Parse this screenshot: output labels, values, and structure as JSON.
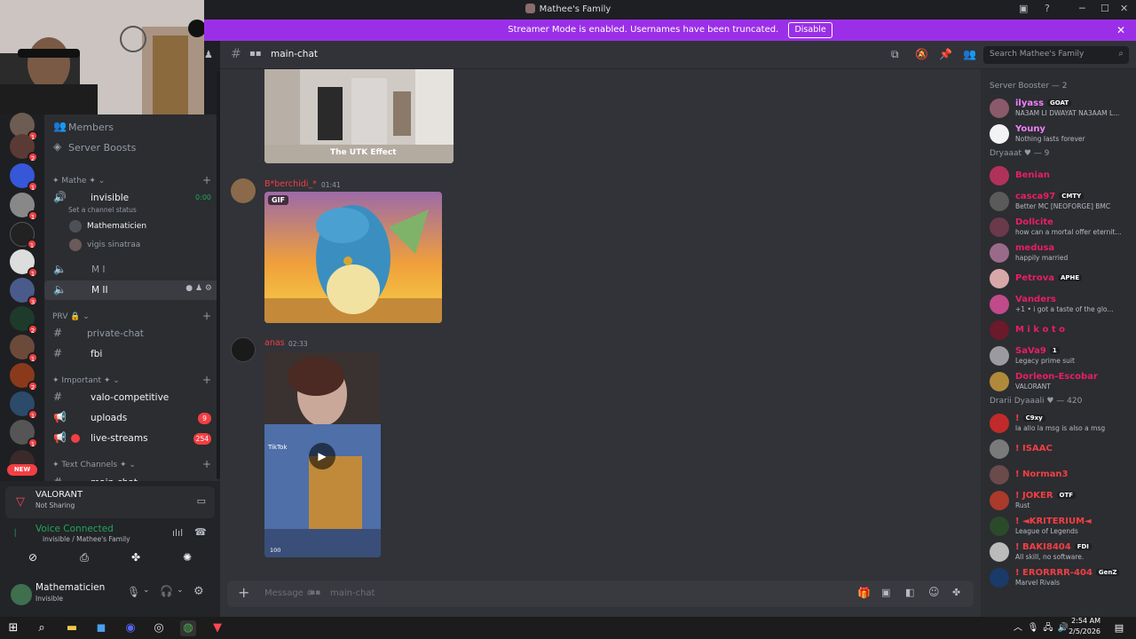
{
  "window": {
    "title": "Mathee's Family"
  },
  "banner": {
    "text": "Streamer Mode is enabled. Usernames have been truncated.",
    "button": "Disable"
  },
  "rail": {
    "badges": [
      "1",
      "2",
      "1",
      "1",
      "1",
      "1",
      "3",
      "2",
      "1",
      "2",
      "1",
      "1"
    ],
    "new_label": "NEW"
  },
  "sidebar": {
    "members_label": "Members",
    "boosts_label": "Server Boosts",
    "category_mathe": "Mathe",
    "voice_invisible": {
      "name": "invisible",
      "timer": "0:00",
      "status": "Set a channel status"
    },
    "voice_users": [
      "Mathematicien",
      "vigis sinatraa"
    ],
    "voice_mi": "M I",
    "voice_mii": "M II",
    "category_prv": "PRV",
    "private_chat": "private-chat",
    "fbi": "fbi",
    "category_important": "Important",
    "valo": "valo-competitive",
    "uploads": "uploads",
    "uploads_count": "9",
    "live": "live-streams",
    "live_count": "254",
    "category_text": "Text Channels",
    "main_chat": "main-chat"
  },
  "activity": {
    "game": "VALORANT",
    "sub": "Not Sharing"
  },
  "voice": {
    "title": "Voice Connected",
    "sub": "invisible / Mathee's Family"
  },
  "user": {
    "name": "Mathematicien",
    "status": "Invisible"
  },
  "chat": {
    "channel": "main-chat",
    "search_placeholder": "Search Mathee's Family",
    "image1_caption": "The UTK Effect",
    "msg1": {
      "author": "B*berchidi_*",
      "time": "01:41",
      "badge": "GIF"
    },
    "msg2": {
      "author": "anas",
      "time": "02:33",
      "tiktok": "TikTok",
      "counter": "100"
    },
    "composer_placeholder": "Message #",
    "composer_channel": "main-chat"
  },
  "members": {
    "booster_header": "Server Booster — 2",
    "boosters": [
      {
        "name": "ilyass",
        "tag": "GOAT",
        "status": "NA3AM LI DWAYAT NA3AAM L...",
        "color": "#f47fff"
      },
      {
        "name": "Youny",
        "tag": "",
        "status": "Nothing lasts forever",
        "color": "#f47fff"
      }
    ],
    "dryaaat_header": "Dryaaat ♥ — 9",
    "dryaaat": [
      {
        "name": "Benian",
        "tag": "",
        "status": "",
        "color": "#e91e63"
      },
      {
        "name": "casca97",
        "tag": "CMTY",
        "status": "Better MC [NEOFORGE] BMC",
        "color": "#e91e63"
      },
      {
        "name": "Dollcite",
        "tag": "",
        "status": "how can a mortal offer eternit...",
        "color": "#e91e63"
      },
      {
        "name": "medusa",
        "tag": "",
        "status": "happily married",
        "color": "#e91e63"
      },
      {
        "name": "Petrova",
        "tag": "APHE",
        "status": "",
        "color": "#e91e63"
      },
      {
        "name": "Vanders",
        "tag": "",
        "status": "+1 • i got a taste of the glo...",
        "color": "#e91e63"
      },
      {
        "name": "M i k o t o",
        "tag": "",
        "status": "",
        "color": "#e91e63"
      },
      {
        "name": "SaVa9",
        "tag": "1",
        "status": "Legacy prime suit",
        "color": "#e91e63"
      },
      {
        "name": "Dorleon-Escobar",
        "tag": "",
        "status": "VALORANT",
        "color": "#e91e63"
      }
    ],
    "drarii_header": "Drarii Dyaaali ♥ — 420",
    "drarii": [
      {
        "name": "!",
        "tag": "C9xy",
        "status": "la allo la msg is also a msg",
        "color": "#f23f43"
      },
      {
        "name": "! ISAAC",
        "tag": "",
        "status": "",
        "color": "#f23f43"
      },
      {
        "name": "! Norman3",
        "tag": "",
        "status": "",
        "color": "#f23f43"
      },
      {
        "name": "! JOKER",
        "tag": "OTF",
        "status": "Rust",
        "color": "#f23f43"
      },
      {
        "name": "! ◄KRITERIUM◄",
        "tag": "",
        "status": "League of Legends",
        "color": "#f23f43"
      },
      {
        "name": "! BAKI8404",
        "tag": "FDI",
        "status": "All skill, no software.",
        "color": "#f23f43"
      },
      {
        "name": "! ERORRRR-404",
        "tag": "GenZ",
        "status": "Marvel Rivals",
        "color": "#f23f43"
      }
    ]
  },
  "taskbar": {
    "time": "2:54 AM",
    "date": "2/5/2026"
  },
  "colors": {
    "accent": "#5865f2",
    "banner": "#9b2fe8",
    "online": "#23a55a",
    "alert": "#f23f43"
  }
}
